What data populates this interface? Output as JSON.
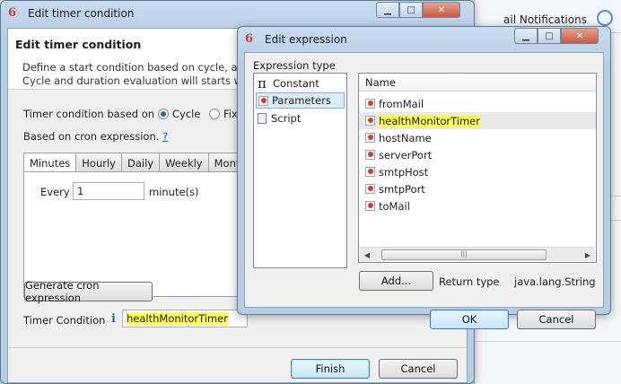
{
  "background_app": {
    "notifications_text": "ail Notifications"
  },
  "timer_window": {
    "title": "Edit timer condition",
    "header_title": "Edit timer condition",
    "description_line1": "Define a start condition based on cycle, a fixed",
    "description_line2": "Cycle and duration evaluation will starts when",
    "based_on_label": "Timer condition based on a",
    "radio_cycle": "Cycle",
    "radio_fixed": "Fix",
    "cron_label": "Based on cron expression.",
    "cron_help": "?",
    "tabs": [
      "Minutes",
      "Hourly",
      "Daily",
      "Weekly",
      "Mont"
    ],
    "every_label": "Every",
    "every_value": "1",
    "unit_label": "minute(s)",
    "generate_button": "Generate cron expression",
    "condition_label": "Timer Condition",
    "info_glyph": "i",
    "condition_value": "healthMonitorTimer",
    "finish_button": "Finish",
    "cancel_button": "Cancel"
  },
  "expression_window": {
    "title": "Edit expression",
    "type_label": "Expression type",
    "types": [
      {
        "glyph": "π",
        "label": "Constant"
      },
      {
        "glyph": "",
        "label": "Parameters"
      },
      {
        "glyph": "",
        "label": "Script"
      }
    ],
    "selected_type": "Parameters",
    "column_name": "Name",
    "parameters": [
      "fromMail",
      "healthMonitorTimer",
      "hostName",
      "serverPort",
      "smtpHost",
      "smtpPort",
      "toMail"
    ],
    "selected_parameter": "healthMonitorTimer",
    "add_button": "Add...",
    "return_type_label": "Return type",
    "return_type_value": "java.lang.String",
    "ok_button": "OK",
    "cancel_button": "Cancel"
  },
  "colors": {
    "highlight": "#fdfd5a",
    "logo": "#d23c2a",
    "link": "#0b5bbd"
  }
}
